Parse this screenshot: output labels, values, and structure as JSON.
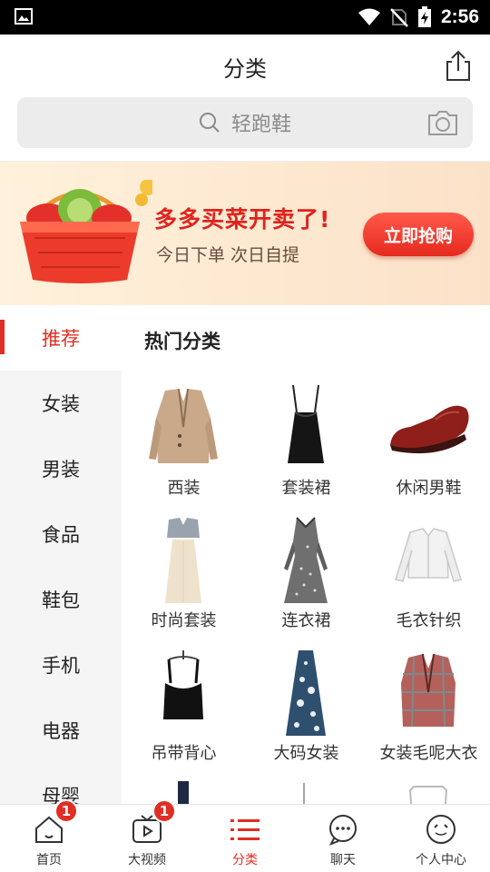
{
  "status_bar": {
    "time": "2:56",
    "icons": [
      "picture-icon",
      "wifi-icon",
      "no-sim-icon",
      "battery-charging-icon"
    ]
  },
  "header": {
    "title": "分类",
    "share_icon": "share-icon"
  },
  "search": {
    "placeholder": "轻跑鞋",
    "search_icon": "search-icon",
    "camera_icon": "camera-icon"
  },
  "banner": {
    "title": "多多买菜开卖了!",
    "subtitle": "今日下单 次日自提",
    "button": "立即抢购"
  },
  "sidebar": {
    "active_index": 0,
    "items": [
      {
        "label": "推荐"
      },
      {
        "label": "女装"
      },
      {
        "label": "男装"
      },
      {
        "label": "食品"
      },
      {
        "label": "鞋包"
      },
      {
        "label": "手机"
      },
      {
        "label": "电器"
      },
      {
        "label": "母婴"
      }
    ]
  },
  "content": {
    "section_title": "热门分类",
    "items": [
      {
        "label": "西装",
        "icon": "blazer-image"
      },
      {
        "label": "套装裙",
        "icon": "black-dress-image"
      },
      {
        "label": "休闲男鞋",
        "icon": "leather-shoe-image"
      },
      {
        "label": "时尚套装",
        "icon": "fashion-set-image"
      },
      {
        "label": "连衣裙",
        "icon": "long-dress-image"
      },
      {
        "label": "毛衣针织",
        "icon": "knit-cardigan-image"
      },
      {
        "label": "吊带背心",
        "icon": "camisole-image"
      },
      {
        "label": "大码女装",
        "icon": "print-dress-image"
      },
      {
        "label": "女装毛呢大衣",
        "icon": "plaid-coat-image"
      },
      {
        "label": "",
        "icon": "bottle-image"
      },
      {
        "label": "",
        "icon": "rack-image"
      },
      {
        "label": "",
        "icon": "chair-image"
      }
    ]
  },
  "tabbar": {
    "active_index": 2,
    "items": [
      {
        "label": "首页",
        "icon": "home-icon",
        "badge": "1"
      },
      {
        "label": "大视频",
        "icon": "video-icon",
        "badge": "1"
      },
      {
        "label": "分类",
        "icon": "category-list-icon",
        "badge": ""
      },
      {
        "label": "聊天",
        "icon": "chat-icon",
        "badge": ""
      },
      {
        "label": "个人中心",
        "icon": "profile-icon",
        "badge": ""
      }
    ]
  },
  "colors": {
    "accent": "#e02e24",
    "sidebar_bg": "#f5f5f5",
    "search_bg": "#ececec",
    "status_bar": "#000000"
  }
}
